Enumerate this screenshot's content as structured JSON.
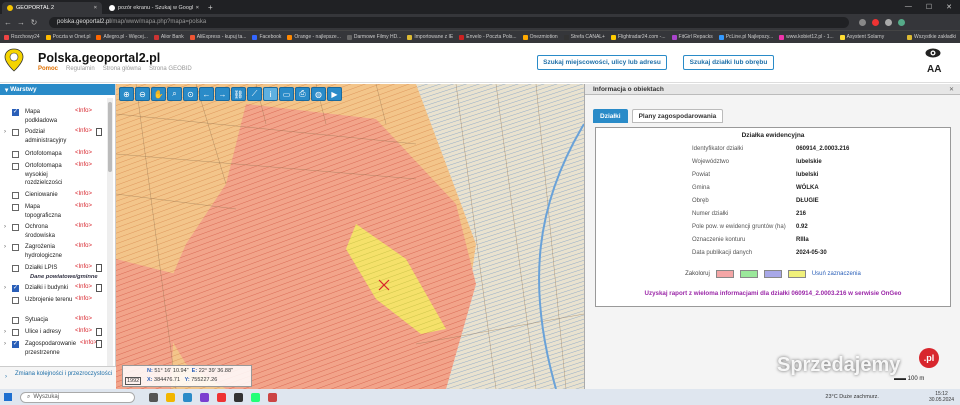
{
  "browser": {
    "tabs": [
      {
        "title": "GEOPORTAL 2",
        "active": true
      },
      {
        "title": "pozór ekranu - Szukaj w Google",
        "active": false
      }
    ],
    "url_host": "polska.geoportal2.pl",
    "url_path": "/map/www/mapa.php?mapa=polska",
    "bookmarks": [
      "Rozchowy24",
      "Poczta w Onet.pl",
      "Allegro.pl - Więcej...",
      "Alior Bank",
      "AliExpress - kupuj ta...",
      "Facebook",
      "Orange - najlepsze...",
      "Darmowe Filmy HD...",
      "Importowane z IE",
      "Envelo - Poczta Pols...",
      "Onezmiotion",
      "Strefa CANAL+",
      "Flightradar24.com -...",
      "FitGirl Repacks",
      "PcLine.pl Najlepszy...",
      "www.kobiet12.pl - 1...",
      "Asystent Solarny"
    ],
    "bookmarks_right": "Wszystkie zakładki"
  },
  "header": {
    "title": "Polska.geoportal2.pl",
    "links": [
      "Pomoc",
      "Regulamin",
      "Strona główna",
      "Strona GEOBID"
    ],
    "search_address_btn": "Szukaj miejscowości, ulicy lub adresu",
    "search_parcel_btn": "Szukaj działki lub obrębu",
    "font_size_label": "AA"
  },
  "sidebar": {
    "heading": "Warstwy",
    "info_label": "<Info>",
    "layers": [
      {
        "label": "Mapa podkładowa",
        "checked": true,
        "expand": false,
        "doc": false
      },
      {
        "label": "Podział administracyjny",
        "checked": false,
        "expand": true,
        "doc": true
      },
      {
        "label": "Ortofotomapa",
        "checked": false,
        "expand": false,
        "doc": false
      },
      {
        "label": "Ortofotomapa wysokiej rozdzielczości",
        "checked": false,
        "expand": false,
        "doc": false
      },
      {
        "label": "Cieniowanie",
        "checked": false,
        "expand": false,
        "doc": false
      },
      {
        "label": "Mapa topograficzna",
        "checked": false,
        "expand": false,
        "doc": false
      },
      {
        "label": "Ochrona środowiska",
        "checked": false,
        "expand": true,
        "doc": false
      },
      {
        "label": "Zagrożenia hydrologiczne",
        "checked": false,
        "expand": true,
        "doc": false
      },
      {
        "label": "Działki LPIS",
        "checked": false,
        "expand": false,
        "doc": true
      },
      {
        "label": "Działki i budynki",
        "checked": true,
        "expand": true,
        "doc": true
      },
      {
        "label": "Uzbrojenie terenu",
        "checked": false,
        "expand": false,
        "doc": false
      },
      {
        "label": "Sytuacja",
        "checked": false,
        "expand": false,
        "doc": false
      },
      {
        "label": "Ulice i adresy",
        "checked": false,
        "expand": true,
        "doc": true
      },
      {
        "label": "Zagospodarowanie przestrzenne",
        "checked": true,
        "expand": true,
        "doc": true
      }
    ],
    "subheading": "Dane powiatowe/gminne",
    "footer_link": "Zmiana kolejności i przezroczystości"
  },
  "map": {
    "coords": {
      "year": "1992",
      "n_label": "N:",
      "n_value": "51° 16' 10.94\"",
      "e_label": "E:",
      "e_value": "22° 39' 36.88\"",
      "x_label": "X:",
      "x_value": "384476.71",
      "y_label": "Y:",
      "y_value": "755227.26"
    },
    "scale_label": "100 m"
  },
  "panel": {
    "title": "Informacja o obiektach",
    "tabs": [
      "Działki",
      "Plany zagospodarowania"
    ],
    "box_title": "Działka ewidencyjna",
    "rows": [
      {
        "label": "Identyfikator działki",
        "value": "060914_2.0003.216"
      },
      {
        "label": "Województwo",
        "value": "lubelskie"
      },
      {
        "label": "Powiat",
        "value": "lubelski"
      },
      {
        "label": "Gmina",
        "value": "WÓLKA"
      },
      {
        "label": "Obręb",
        "value": "DŁUGIE"
      },
      {
        "label": "Numer działki",
        "value": "216"
      },
      {
        "label": "Pole pow. w ewidencji gruntów (ha)",
        "value": "0.92"
      },
      {
        "label": "Oznaczenie konturu",
        "value": "RIIIa"
      },
      {
        "label": "Data publikacji danych",
        "value": "2024-05-30"
      }
    ],
    "colorize_label": "Zakoloruj",
    "colorize_swatches": [
      "#f4a6a6",
      "#9be89b",
      "#a8a8e8",
      "#f0f07a"
    ],
    "clear_label": "Usuń zaznaczenia",
    "report_text": "Uzyskaj raport z wieloma informacjami dla działki 060914_2.0003.216 w serwisie OnGeo"
  },
  "watermark": "Sprzedajemy",
  "watermark_suffix": ".pl",
  "taskbar": {
    "search_placeholder": "Wyszukaj",
    "weather": "23°C  Duże zachmurz.",
    "time": "15:12",
    "date": "30.05.2024"
  }
}
